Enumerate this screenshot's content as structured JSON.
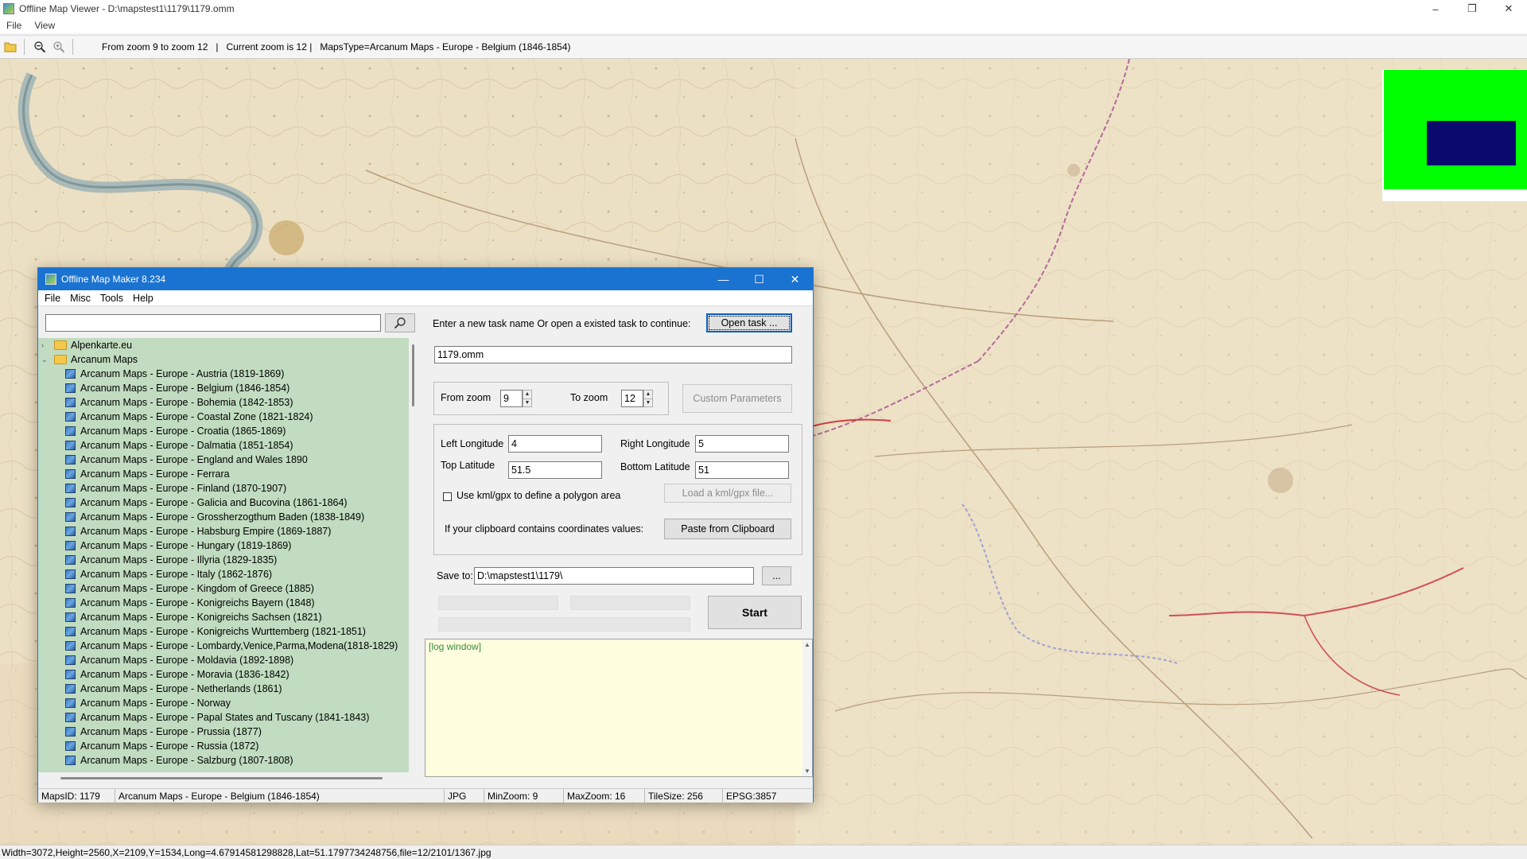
{
  "main_window": {
    "title": "Offline Map Viewer - D:\\mapstest1\\1179\\1179.omm",
    "menu": [
      "File",
      "View"
    ],
    "toolbar": {
      "status": "From zoom 9 to zoom 12   |   Current zoom is 12 |   MapsType=Arcanum Maps - Europe - Belgium (1846-1854)"
    },
    "status_bar": "Width=3072,Height=2560,X=2109,Y=1534,Long=4.67914581298828,Lat=51.1797734248756,file=12/2101/1367.jpg",
    "window_buttons": [
      "–",
      "❐",
      "✕"
    ]
  },
  "dialog": {
    "title": "Offline Map Maker 8.234",
    "menu": [
      "File",
      "Misc",
      "Tools",
      "Help"
    ],
    "search": {
      "value": "",
      "icon": "search-icon"
    },
    "tree": {
      "folders": [
        "Alpenkarte.eu",
        "Arcanum Maps"
      ],
      "items": [
        "Arcanum Maps - Europe - Austria (1819-1869)",
        "Arcanum Maps - Europe - Belgium (1846-1854)",
        "Arcanum Maps - Europe - Bohemia (1842-1853)",
        "Arcanum Maps - Europe - Coastal Zone (1821-1824)",
        "Arcanum Maps - Europe - Croatia (1865-1869)",
        "Arcanum Maps - Europe - Dalmatia (1851-1854)",
        "Arcanum Maps - Europe - England and Wales 1890",
        "Arcanum Maps - Europe - Ferrara",
        "Arcanum Maps - Europe - Finland (1870-1907)",
        "Arcanum Maps - Europe - Galicia and Bucovina (1861-1864)",
        "Arcanum Maps - Europe - Grossherzogthum Baden (1838-1849)",
        "Arcanum Maps - Europe - Habsburg Empire (1869-1887)",
        "Arcanum Maps - Europe - Hungary (1819-1869)",
        "Arcanum Maps - Europe - Illyria (1829-1835)",
        "Arcanum Maps - Europe - Italy (1862-1876)",
        "Arcanum Maps - Europe - Kingdom of Greece (1885)",
        "Arcanum Maps - Europe - Konigreichs Bayern (1848)",
        "Arcanum Maps - Europe - Konigreichs Sachsen (1821)",
        "Arcanum Maps - Europe - Konigreichs Wurttemberg (1821-1851)",
        "Arcanum Maps - Europe - Lombardy,Venice,Parma,Modena(1818-1829)",
        "Arcanum Maps - Europe - Moldavia (1892-1898)",
        "Arcanum Maps - Europe - Moravia (1836-1842)",
        "Arcanum Maps - Europe - Netherlands (1861)",
        "Arcanum Maps - Europe - Norway",
        "Arcanum Maps - Europe - Papal States and Tuscany (1841-1843)",
        "Arcanum Maps - Europe - Prussia (1877)",
        "Arcanum Maps - Europe - Russia (1872)",
        "Arcanum Maps - Europe - Salzburg (1807-1808)"
      ]
    },
    "task": {
      "prompt": "Enter a new task name Or open a existed task to continue:",
      "open_button": "Open task ...",
      "name_value": "1179.omm"
    },
    "zoom": {
      "from_label": "From zoom",
      "from_value": "9",
      "to_label": "To zoom",
      "to_value": "12",
      "custom_button": "Custom Parameters"
    },
    "coords": {
      "left_lon_label": "Left Longitude",
      "left_lon_value": "4",
      "right_lon_label": "Right Longitude",
      "right_lon_value": "5",
      "top_lat_label": "Top Latitude",
      "top_lat_value": "51.5",
      "bottom_lat_label": "Bottom Latitude",
      "bottom_lat_value": "51",
      "kml_checkbox_label": "Use kml/gpx to define a polygon area",
      "kml_checked": false,
      "load_kml_button": "Load a kml/gpx file...",
      "clipboard_label": "If your clipboard contains coordinates values:",
      "paste_button": "Paste from Clipboard"
    },
    "save": {
      "label": "Save to:",
      "value": "D:\\mapstest1\\1179\\",
      "browse_button": "...",
      "start_button": "Start"
    },
    "log": {
      "text": "[log window]"
    },
    "status_bar": {
      "maps_id": "MapsID: 1179",
      "map_name": "Arcanum Maps - Europe - Belgium (1846-1854)",
      "format": "JPG",
      "min_zoom": "MinZoom: 9",
      "max_zoom": "MaxZoom: 16",
      "tile_size": "TileSize: 256",
      "epsg": "EPSG:3857"
    }
  },
  "colors": {
    "dialog_title": "#1a73d1",
    "tree_bg": "#c1dcc0",
    "log_bg": "#ffffe0",
    "overview_green": "#00ff00",
    "overview_navy": "#0a0a6e",
    "map_paper": "#ede0c6"
  }
}
